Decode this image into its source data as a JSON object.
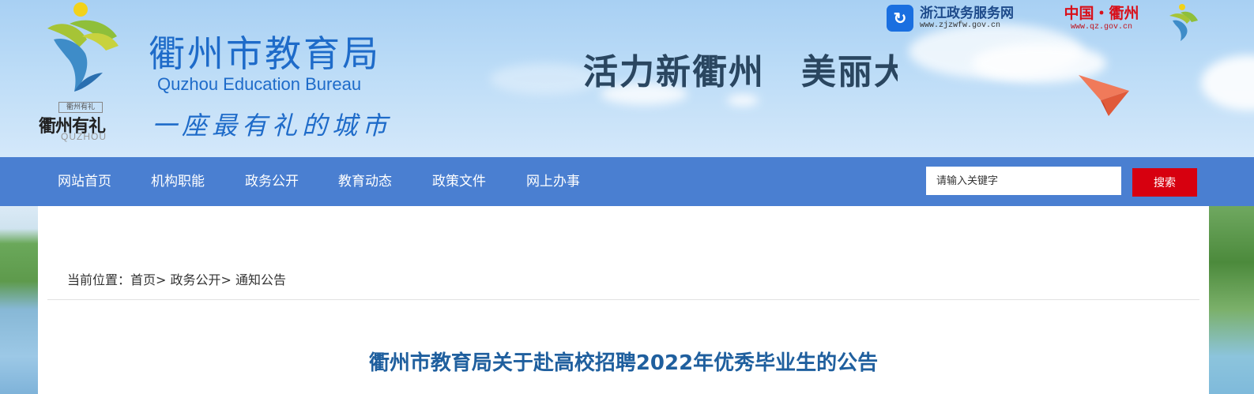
{
  "header": {
    "logo": {
      "seal_text": "衢州有礼",
      "name_cn": "衢州有礼",
      "name_en": "QUZHOU"
    },
    "title_cn": "衢州市教育局",
    "title_en": "Quzhou Education Bureau",
    "slogan": "一座最有礼的城市",
    "motto": "活力新衢州　美丽大花园",
    "links": {
      "zhejiang": {
        "name": "浙江政务服务网",
        "url_text": "www.zjzwfw.gov.cn",
        "icon": "zhejiang-gov-icon"
      },
      "quzhou": {
        "name": "中国・衢州",
        "url_text": "www.qz.gov.cn"
      }
    }
  },
  "nav": {
    "items": [
      {
        "label": "网站首页"
      },
      {
        "label": "机构职能"
      },
      {
        "label": "政务公开"
      },
      {
        "label": "教育动态"
      },
      {
        "label": "政策文件"
      },
      {
        "label": "网上办事"
      }
    ],
    "search": {
      "placeholder": "请输入关键字",
      "button_label": "搜索"
    }
  },
  "breadcrumb": {
    "prefix": "当前位置：",
    "items": [
      {
        "label": "首页"
      },
      {
        "label": "政务公开"
      },
      {
        "label": "通知公告"
      }
    ],
    "separator": ">"
  },
  "article": {
    "title": "衢州市教育局关于赴高校招聘2022年优秀毕业生的公告"
  },
  "colors": {
    "nav_bg": "#4a7fd1",
    "search_button": "#d7000f",
    "title_blue": "#1e6bc9",
    "article_title": "#1f5f9e"
  }
}
